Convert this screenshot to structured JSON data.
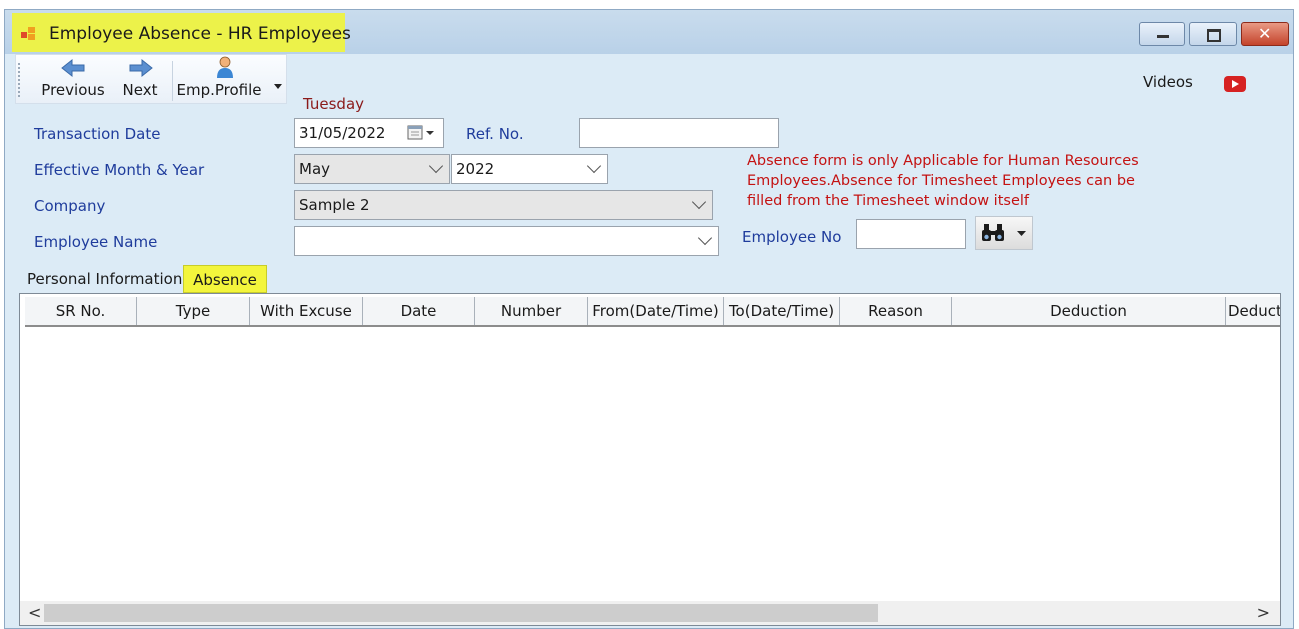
{
  "window": {
    "title": "Employee Absence - HR Employees"
  },
  "toolbar": {
    "previous_label": "Previous",
    "next_label": "Next",
    "profile_label": "Emp.Profile",
    "videos_label": "Videos"
  },
  "day_label": "Tuesday",
  "form": {
    "transaction_date_label": "Transaction Date",
    "transaction_date_value": "31/05/2022",
    "ref_no_label": "Ref. No.",
    "ref_no_value": "",
    "effective_label": "Effective Month & Year",
    "month_value": "May",
    "year_value": "2022",
    "company_label": "Company",
    "company_value": "Sample 2",
    "employee_name_label": "Employee Name",
    "employee_name_value": "",
    "employee_no_label": "Employee No",
    "employee_no_value": ""
  },
  "notice": "Absence form is only Applicable for Human Resources Employees.Absence for Timesheet Employees can be filled from the Timesheet window itself",
  "tabs": [
    {
      "label": "Personal Information",
      "active": false
    },
    {
      "label": "Absence",
      "active": true
    }
  ],
  "grid": {
    "columns": [
      "SR No.",
      "Type",
      "With Excuse",
      "Date",
      "Number",
      "From(Date/Time)",
      "To(Date/Time)",
      "Reason",
      "Deduction",
      "Deduct"
    ],
    "rows": []
  },
  "colors": {
    "highlight": "#ecf24a",
    "label_blue": "#1f3c9c",
    "notice_red": "#c41212",
    "day_red": "#8b1a1a",
    "window_bg": "#dcebf6"
  }
}
